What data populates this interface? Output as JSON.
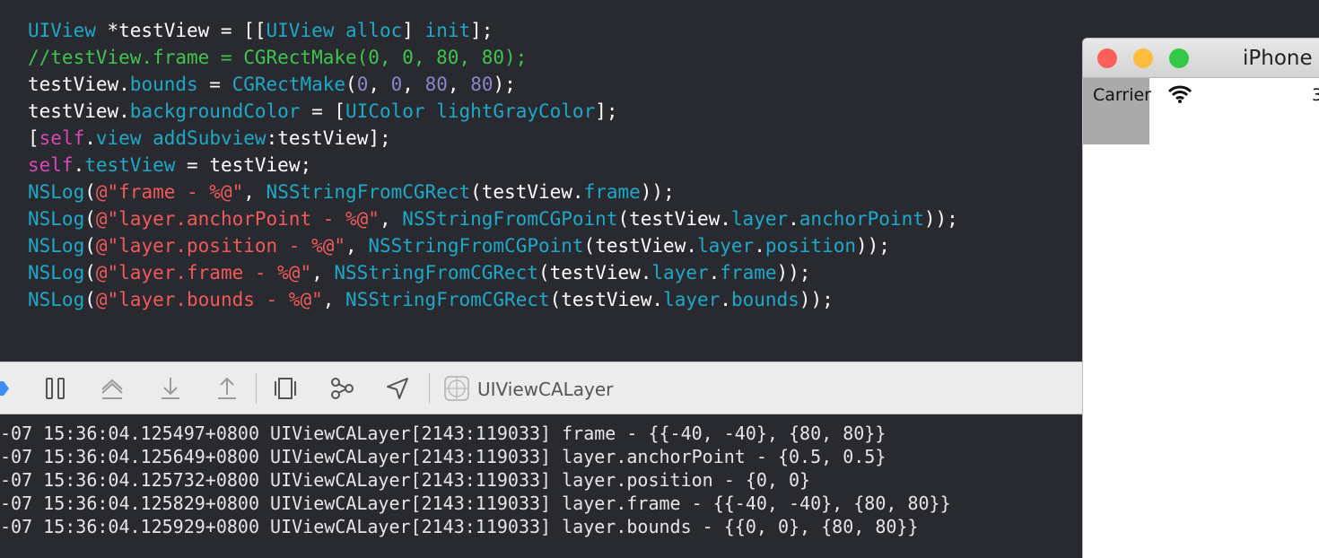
{
  "editor": {
    "lines": [
      [
        {
          "t": "UIView",
          "c": "type"
        },
        {
          "t": " *testView = [[",
          "c": "plain"
        },
        {
          "t": "UIView",
          "c": "type"
        },
        {
          "t": " ",
          "c": "plain"
        },
        {
          "t": "alloc",
          "c": "method"
        },
        {
          "t": "] ",
          "c": "plain"
        },
        {
          "t": "init",
          "c": "method"
        },
        {
          "t": "];",
          "c": "plain"
        }
      ],
      [
        {
          "t": "//testView.frame = CGRectMake(0, 0, 80, 80);",
          "c": "comment"
        }
      ],
      [
        {
          "t": "testView.",
          "c": "plain"
        },
        {
          "t": "bounds",
          "c": "prop"
        },
        {
          "t": " = ",
          "c": "plain"
        },
        {
          "t": "CGRectMake",
          "c": "method"
        },
        {
          "t": "(",
          "c": "plain"
        },
        {
          "t": "0",
          "c": "number"
        },
        {
          "t": ", ",
          "c": "plain"
        },
        {
          "t": "0",
          "c": "number"
        },
        {
          "t": ", ",
          "c": "plain"
        },
        {
          "t": "80",
          "c": "number"
        },
        {
          "t": ", ",
          "c": "plain"
        },
        {
          "t": "80",
          "c": "number"
        },
        {
          "t": ");",
          "c": "plain"
        }
      ],
      [
        {
          "t": "testView.",
          "c": "plain"
        },
        {
          "t": "backgroundColor",
          "c": "prop"
        },
        {
          "t": " = [",
          "c": "plain"
        },
        {
          "t": "UIColor",
          "c": "type"
        },
        {
          "t": " ",
          "c": "plain"
        },
        {
          "t": "lightGrayColor",
          "c": "method"
        },
        {
          "t": "];",
          "c": "plain"
        }
      ],
      [
        {
          "t": "[",
          "c": "plain"
        },
        {
          "t": "self",
          "c": "keyword"
        },
        {
          "t": ".",
          "c": "plain"
        },
        {
          "t": "view",
          "c": "prop"
        },
        {
          "t": " ",
          "c": "plain"
        },
        {
          "t": "addSubview",
          "c": "method"
        },
        {
          "t": ":testView];",
          "c": "plain"
        }
      ],
      [
        {
          "t": "self",
          "c": "keyword"
        },
        {
          "t": ".",
          "c": "plain"
        },
        {
          "t": "testView",
          "c": "prop"
        },
        {
          "t": " = testView;",
          "c": "plain"
        }
      ],
      [
        {
          "t": "NSLog",
          "c": "method"
        },
        {
          "t": "(",
          "c": "plain"
        },
        {
          "t": "@\"frame - %@\"",
          "c": "string"
        },
        {
          "t": ", ",
          "c": "plain"
        },
        {
          "t": "NSStringFromCGRect",
          "c": "method"
        },
        {
          "t": "(testView.",
          "c": "plain"
        },
        {
          "t": "frame",
          "c": "prop"
        },
        {
          "t": "));",
          "c": "plain"
        }
      ],
      [
        {
          "t": "NSLog",
          "c": "method"
        },
        {
          "t": "(",
          "c": "plain"
        },
        {
          "t": "@\"layer.anchorPoint - %@\"",
          "c": "string"
        },
        {
          "t": ", ",
          "c": "plain"
        },
        {
          "t": "NSStringFromCGPoint",
          "c": "method"
        },
        {
          "t": "(testView.",
          "c": "plain"
        },
        {
          "t": "layer",
          "c": "prop"
        },
        {
          "t": ".",
          "c": "plain"
        },
        {
          "t": "anchorPoint",
          "c": "prop"
        },
        {
          "t": "));",
          "c": "plain"
        }
      ],
      [
        {
          "t": "NSLog",
          "c": "method"
        },
        {
          "t": "(",
          "c": "plain"
        },
        {
          "t": "@\"layer.position - %@\"",
          "c": "string"
        },
        {
          "t": ", ",
          "c": "plain"
        },
        {
          "t": "NSStringFromCGPoint",
          "c": "method"
        },
        {
          "t": "(testView.",
          "c": "plain"
        },
        {
          "t": "layer",
          "c": "prop"
        },
        {
          "t": ".",
          "c": "plain"
        },
        {
          "t": "position",
          "c": "prop"
        },
        {
          "t": "));",
          "c": "plain"
        }
      ],
      [
        {
          "t": "NSLog",
          "c": "method"
        },
        {
          "t": "(",
          "c": "plain"
        },
        {
          "t": "@\"layer.frame - %@\"",
          "c": "string"
        },
        {
          "t": ", ",
          "c": "plain"
        },
        {
          "t": "NSStringFromCGRect",
          "c": "method"
        },
        {
          "t": "(testView.",
          "c": "plain"
        },
        {
          "t": "layer",
          "c": "prop"
        },
        {
          "t": ".",
          "c": "plain"
        },
        {
          "t": "frame",
          "c": "prop"
        },
        {
          "t": "));",
          "c": "plain"
        }
      ],
      [
        {
          "t": "NSLog",
          "c": "method"
        },
        {
          "t": "(",
          "c": "plain"
        },
        {
          "t": "@\"layer.bounds - %@\"",
          "c": "string"
        },
        {
          "t": ", ",
          "c": "plain"
        },
        {
          "t": "NSStringFromCGRect",
          "c": "method"
        },
        {
          "t": "(testView.",
          "c": "plain"
        },
        {
          "t": "layer",
          "c": "prop"
        },
        {
          "t": ".",
          "c": "plain"
        },
        {
          "t": "bounds",
          "c": "prop"
        },
        {
          "t": "));",
          "c": "plain"
        }
      ]
    ]
  },
  "debug_bar": {
    "target_label": "UIViewCALayer",
    "buttons": [
      "breakpoint-toggle-icon",
      "pause-icon",
      "step-over-icon",
      "step-into-icon",
      "step-out-icon",
      "view-hierarchy-icon",
      "memory-graph-icon",
      "location-icon",
      "app-target-icon"
    ]
  },
  "console": {
    "lines": [
      "-07 15:36:04.125497+0800 UIViewCALayer[2143:119033] frame - {{-40, -40}, {80, 80}}",
      "-07 15:36:04.125649+0800 UIViewCALayer[2143:119033] layer.anchorPoint - {0.5, 0.5}",
      "-07 15:36:04.125732+0800 UIViewCALayer[2143:119033] layer.position - {0, 0}",
      "-07 15:36:04.125829+0800 UIViewCALayer[2143:119033] layer.frame - {{-40, -40}, {80, 80}}",
      "-07 15:36:04.125929+0800 UIViewCALayer[2143:119033] layer.bounds - {{0, 0}, {80, 80}}"
    ]
  },
  "simulator": {
    "title": "iPhone",
    "carrier": "Carrier",
    "time": "3",
    "view_color": "#aaaaaa",
    "traffic_colors": [
      "#fc605b",
      "#fdbc40",
      "#34c84a"
    ]
  }
}
